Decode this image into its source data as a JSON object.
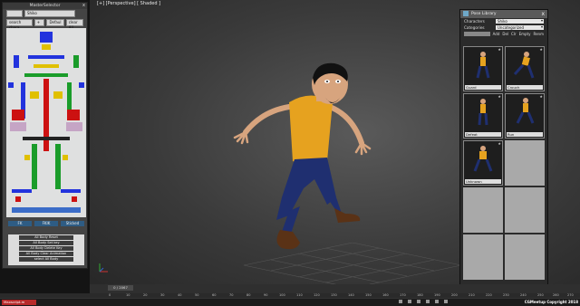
{
  "viewport": {
    "label": "[+] [Perspective] [ Shaded ]"
  },
  "master_selector": {
    "title": "MasterSelector",
    "close": "x",
    "character_value": "Shiko",
    "buttons": [
      "search chara..",
      "+",
      "Defaul",
      "clear All"
    ],
    "footer_buttons": [
      "FK",
      "FKIK",
      "Sticked"
    ],
    "actions": [
      "All Body Reset",
      "All Body Set key",
      "All Body Delete Key",
      "All Body Clear Animation",
      "select All Body"
    ]
  },
  "pose_library": {
    "title": "Pose Library",
    "close": "x",
    "characters_label": "Characters",
    "characters_value": "Shiko",
    "categories_label": "Categories",
    "categories_value": "Uncategorized",
    "tools": [
      "Add",
      "Del",
      "Clr",
      "Empty",
      "Renm"
    ],
    "poses": [
      {
        "name": "Guard"
      },
      {
        "name": "Crouch"
      },
      {
        "name": "Defeat"
      },
      {
        "name": "Run"
      },
      {
        "name": "Unknown"
      }
    ],
    "footer": {
      "refresh": "Refresh",
      "purge": "Purge"
    }
  },
  "timeline": {
    "frame": "0 / 2067",
    "ticks": [
      "0",
      "10",
      "20",
      "30",
      "40",
      "50",
      "60",
      "70",
      "80",
      "90",
      "100",
      "110",
      "120",
      "130",
      "140",
      "150",
      "160",
      "170",
      "180",
      "190",
      "200",
      "210",
      "220",
      "230",
      "240",
      "250",
      "260",
      "270"
    ]
  },
  "status": {
    "script_label": "Maxscript.m",
    "copyright": "CGMeetup Copyright 2018"
  },
  "colors": {
    "accent": "#2e5c84",
    "panel": "#444444"
  }
}
